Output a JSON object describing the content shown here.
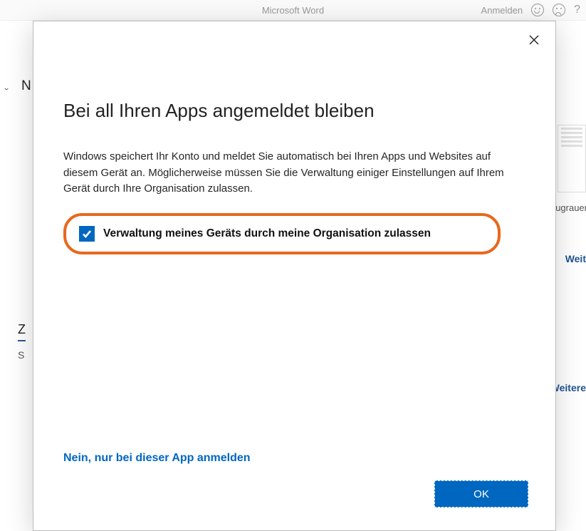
{
  "bg": {
    "app_title": "Microsoft Word",
    "anmelden": "Anmelden",
    "help": "?",
    "letter_N": "N",
    "chevron": "⌄",
    "thumb_label": "ugrauer",
    "link1": "Weit",
    "letter_Z": "Z",
    "letter_S": "S",
    "link2": "Weitere"
  },
  "dialog": {
    "title": "Bei all Ihren Apps angemeldet bleiben",
    "description": "Windows speichert Ihr Konto und meldet Sie automatisch bei Ihren Apps und Websites auf diesem Gerät an. Möglicherweise müssen Sie die Verwaltung einiger Einstellungen auf Ihrem Gerät durch Ihre Organisation zulassen.",
    "checkbox_label": "Verwaltung meines Geräts durch meine Organisation zulassen",
    "checkbox_checked": true,
    "link_only_this_app": "Nein, nur bei dieser App anmelden",
    "ok": "OK"
  }
}
